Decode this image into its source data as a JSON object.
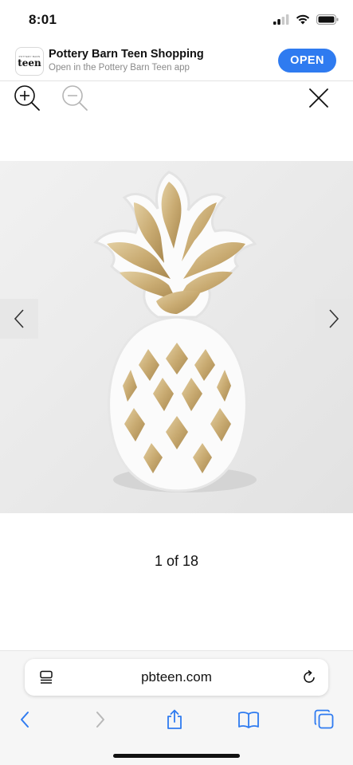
{
  "status_bar": {
    "time": "8:01"
  },
  "app_banner": {
    "logo_text": "teen",
    "logo_small_text": "POTTERY BARN",
    "title": "Pottery Barn Teen Shopping",
    "subtitle": "Open in the Pottery Barn Teen app",
    "open_label": "OPEN",
    "accent_color": "#2f7bf0"
  },
  "toolbar": {
    "zoom_in_icon": "zoom-in-icon",
    "zoom_out_icon": "zoom-out-icon",
    "close_icon": "close-icon"
  },
  "gallery": {
    "counter": "1 of 18",
    "prev_icon": "chevron-left-icon",
    "next_icon": "chevron-right-icon"
  },
  "browser": {
    "url": "pbteen.com",
    "accent_color": "#2f7bf0",
    "toolbar_icons": [
      "back-icon",
      "forward-icon",
      "share-icon",
      "bookmarks-icon",
      "tabs-icon"
    ]
  }
}
